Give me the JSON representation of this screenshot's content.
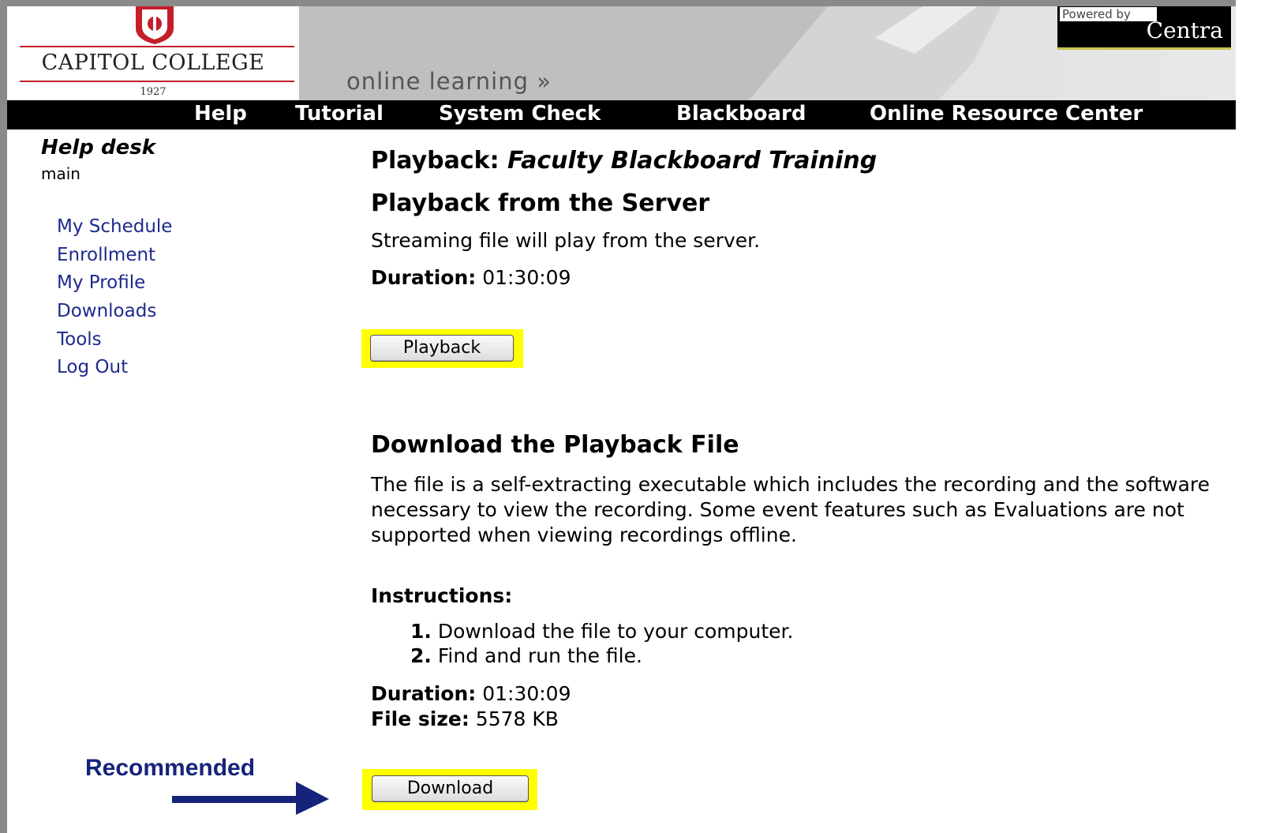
{
  "header": {
    "logo_text": "CAPITOL COLLEGE",
    "logo_year": "1927",
    "tagline": "online learning »",
    "powered_label": "Powered by",
    "powered_brand": "Centra"
  },
  "nav": {
    "items": [
      {
        "label": "Help"
      },
      {
        "label": "Tutorial"
      },
      {
        "label": "System Check"
      },
      {
        "label": "Blackboard"
      },
      {
        "label": "Online Resource Center"
      }
    ]
  },
  "sidebar": {
    "title": "Help desk",
    "subtitle": "main",
    "links": [
      {
        "label": "My Schedule"
      },
      {
        "label": "Enrollment"
      },
      {
        "label": "My Profile"
      },
      {
        "label": "Downloads"
      },
      {
        "label": "Tools"
      },
      {
        "label": "Log Out"
      }
    ]
  },
  "main": {
    "title_prefix": "Playback: ",
    "title_name": "Faculty Blackboard Training",
    "server": {
      "heading": "Playback from the Server",
      "description": "Streaming file will play from the server.",
      "duration_label": "Duration:",
      "duration_value": " 01:30:09",
      "button_label": "Playback"
    },
    "download": {
      "heading": "Download the Playback File",
      "description": "The file is a self-extracting executable which includes the recording and the software necessary to view the recording. Some event features such as Evaluations are not supported when viewing recordings offline.",
      "instructions_label": "Instructions:",
      "steps": [
        {
          "num": "1.",
          "text": " Download the file to your computer."
        },
        {
          "num": "2.",
          "text": " Find and run the file."
        }
      ],
      "duration_label": "Duration:",
      "duration_value": " 01:30:09",
      "size_label": "File size:",
      "size_value": " 5578 KB",
      "button_label": "Download"
    }
  },
  "annotation": {
    "label": "Recommended"
  },
  "colors": {
    "link": "#1d2a8c",
    "highlight": "#ffff00",
    "annotation": "#16237a",
    "brand_red": "#c41e2a"
  }
}
